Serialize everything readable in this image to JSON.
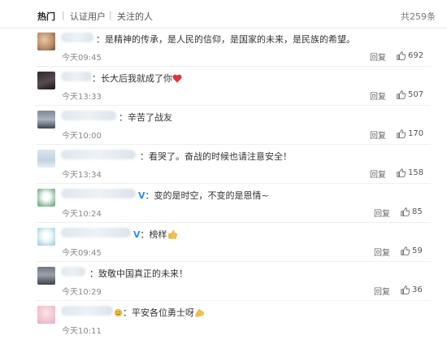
{
  "tabs": {
    "hot": "热门",
    "verified": "认证用户",
    "following": "关注的人",
    "total": "共259条"
  },
  "actions": {
    "reply": "回复"
  },
  "icons": {
    "like": "thumbs-up-icon",
    "heart": "heart-emoji-icon",
    "thumb": "thumbs-up-emoji-icon",
    "strong": "flexed-bicep-emoji-icon",
    "verified": "verified-v-badge-icon",
    "smile": "smile-emoji-icon"
  },
  "colors": {
    "verified": "#2c8cf1",
    "heart": "#e0343a",
    "emoji": "#f4c04a"
  },
  "comments": [
    {
      "text": "：是精神的传承，是人民的信仰，是国家的未来，是民族的希望。",
      "time": "今天09:45",
      "likes": "692"
    },
    {
      "text": "：长大后我就成了你",
      "time": "今天13:33",
      "likes": "507"
    },
    {
      "text": "：辛苦了战友",
      "time": "今天10:00",
      "likes": "170"
    },
    {
      "text": "：看哭了。奋战的时候也请注意安全！",
      "time": "今天13:34",
      "likes": "158"
    },
    {
      "text": "：变的是时空，不变的是恩情~",
      "time": "今天10:24",
      "likes": "85"
    },
    {
      "text": "：榜样",
      "time": "今天09:45",
      "likes": "59"
    },
    {
      "text": "：致敬中国真正的未来！",
      "time": "今天10:29",
      "likes": "36"
    },
    {
      "text": "：平安各位勇士呀",
      "time": "今天10:11",
      "likes": ""
    }
  ]
}
